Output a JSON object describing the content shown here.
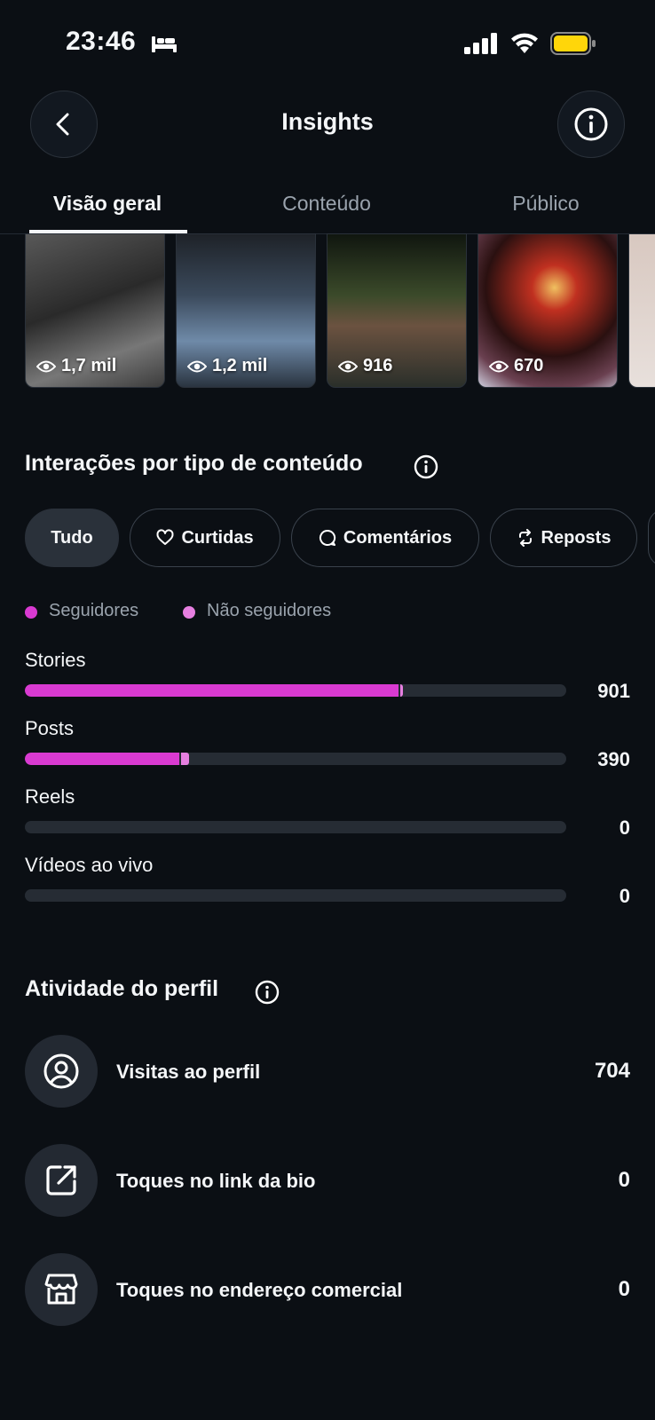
{
  "status_bar": {
    "time": "23:46"
  },
  "header": {
    "title": "Insights"
  },
  "tabs": [
    {
      "label": "Visão geral",
      "active": true
    },
    {
      "label": "Conteúdo",
      "active": false
    },
    {
      "label": "Público",
      "active": false
    }
  ],
  "thumbnails": [
    {
      "views": "1,7 mil"
    },
    {
      "views": "1,2 mil"
    },
    {
      "views": "916"
    },
    {
      "views": "670"
    }
  ],
  "interactions": {
    "title": "Interações por tipo de conteúdo",
    "filters": [
      {
        "label": "Tudo",
        "icon": "none",
        "active": true
      },
      {
        "label": "Curtidas",
        "icon": "heart-icon"
      },
      {
        "label": "Comentários",
        "icon": "comment-icon"
      },
      {
        "label": "Reposts",
        "icon": "repost-icon"
      }
    ],
    "legend": [
      {
        "label": "Seguidores",
        "color": "#d93ad1"
      },
      {
        "label": "Não seguidores",
        "color": "#e67fe0"
      }
    ],
    "rows": [
      {
        "label": "Stories",
        "value": "901",
        "followers_fraction": 0.69,
        "non_followers_fraction": 0.005
      },
      {
        "label": "Posts",
        "value": "390",
        "followers_fraction": 0.285,
        "non_followers_fraction": 0.015
      },
      {
        "label": "Reels",
        "value": "0",
        "followers_fraction": 0,
        "non_followers_fraction": 0
      },
      {
        "label": "Vídeos ao vivo",
        "value": "0",
        "followers_fraction": 0,
        "non_followers_fraction": 0
      }
    ]
  },
  "activity": {
    "title": "Atividade do perfil",
    "rows": [
      {
        "label": "Visitas ao perfil",
        "value": "704",
        "icon": "profile-icon"
      },
      {
        "label": "Toques no link da bio",
        "value": "0",
        "icon": "external-link-icon"
      },
      {
        "label": "Toques no endereço comercial",
        "value": "0",
        "icon": "storefront-icon"
      }
    ]
  }
}
